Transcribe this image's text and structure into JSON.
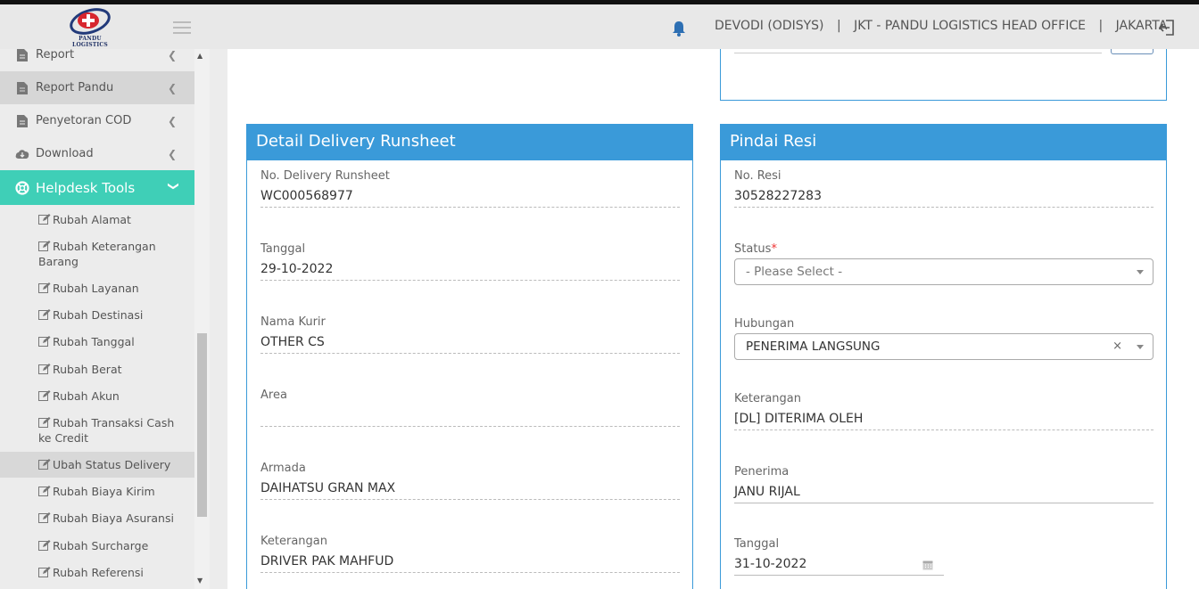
{
  "header": {
    "logo_text": "PANDU LOGISTICS",
    "user": "DEVODI (ODISYS)",
    "separator": "|",
    "office": "JKT - PANDU LOGISTICS HEAD OFFICE",
    "city": "JAKARTA"
  },
  "sidebar": {
    "items": [
      {
        "label": "Report"
      },
      {
        "label": "Report Pandu"
      },
      {
        "label": "Penyetoran COD"
      },
      {
        "label": "Download"
      },
      {
        "label": "Helpdesk Tools"
      }
    ],
    "sub": [
      {
        "label": "Rubah Alamat"
      },
      {
        "label": "Rubah Keterangan Barang"
      },
      {
        "label": "Rubah Layanan"
      },
      {
        "label": "Rubah Destinasi"
      },
      {
        "label": "Rubah Tanggal"
      },
      {
        "label": "Rubah Berat"
      },
      {
        "label": "Rubah Akun"
      },
      {
        "label": "Rubah Transaksi Cash ke Credit"
      },
      {
        "label": "Ubah Status Delivery"
      },
      {
        "label": "Rubah Biaya Kirim"
      },
      {
        "label": "Rubah Biaya Asuransi"
      },
      {
        "label": "Rubah Surcharge"
      },
      {
        "label": "Rubah Referensi"
      }
    ]
  },
  "detail": {
    "title": "Detail Delivery Runsheet",
    "fields": [
      {
        "label": "No. Delivery Runsheet",
        "value": "WC000568977"
      },
      {
        "label": "Tanggal",
        "value": "29-10-2022"
      },
      {
        "label": "Nama Kurir",
        "value": "OTHER CS"
      },
      {
        "label": "Area",
        "value": ""
      },
      {
        "label": "Armada",
        "value": "DAIHATSU GRAN MAX"
      },
      {
        "label": "Keterangan",
        "value": "DRIVER PAK MAHFUD"
      }
    ]
  },
  "pindai": {
    "title": "Pindai Resi",
    "no_resi": {
      "label": "No. Resi",
      "value": "30528227283"
    },
    "status": {
      "label": "Status",
      "required": "*",
      "placeholder": "- Please Select -"
    },
    "hubungan": {
      "label": "Hubungan",
      "value": "PENERIMA LANGSUNG",
      "clear": "×"
    },
    "keterangan": {
      "label": "Keterangan",
      "value": "[DL] DITERIMA OLEH"
    },
    "penerima": {
      "label": "Penerima",
      "value": "JANU RIJAL"
    },
    "tanggal": {
      "label": "Tanggal",
      "value": "31-10-2022"
    }
  },
  "colors": {
    "accent": "#3a9ad9",
    "helpdesk": "#3fcfb7"
  },
  "icons": [
    "bell-icon",
    "logout-icon",
    "file-icon",
    "cloud-download-icon",
    "lifebuoy-icon",
    "edit-icon",
    "calendar-icon"
  ]
}
